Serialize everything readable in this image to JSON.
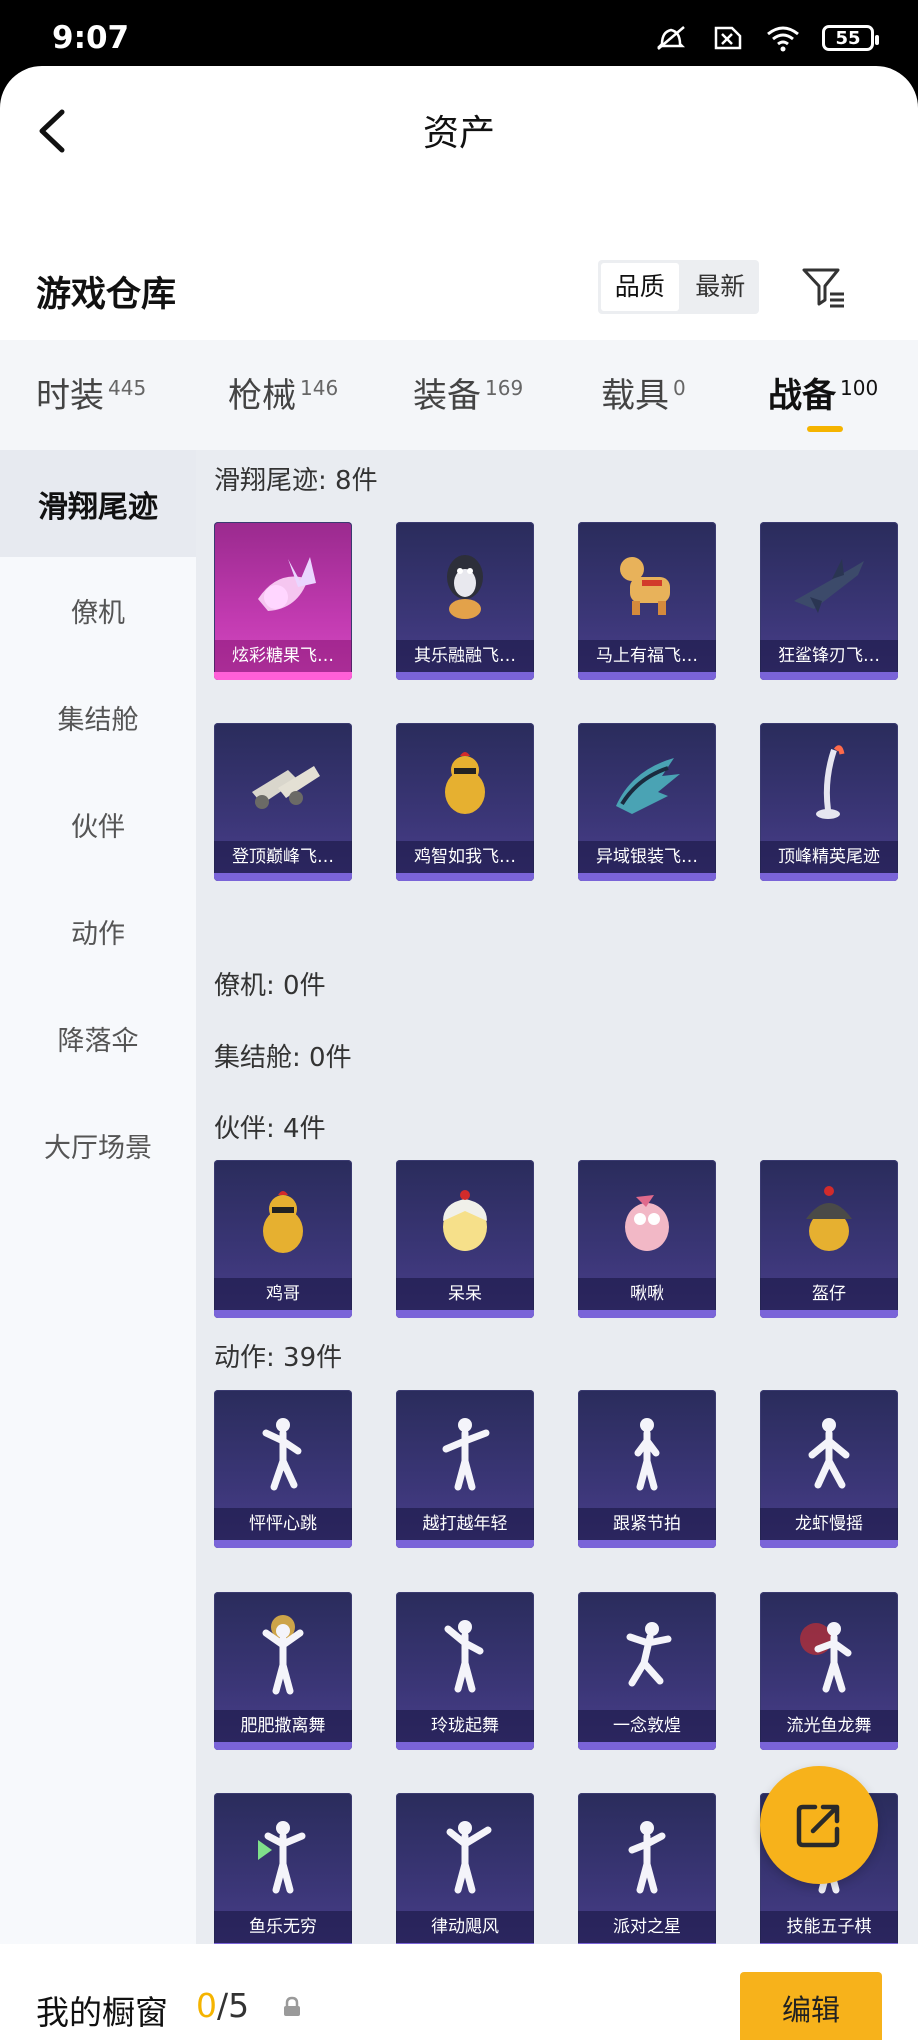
{
  "status_bar": {
    "time": "9:07",
    "battery": "55",
    "icons": [
      "mute-icon",
      "sim-off-icon",
      "wifi-icon",
      "battery-icon"
    ]
  },
  "nav": {
    "title": "资产",
    "back_icon": "chevron-left-icon"
  },
  "warehouse": {
    "title": "游戏仓库",
    "sort_options": [
      "品质",
      "最新"
    ],
    "active_sort": "品质",
    "filter_icon": "filter-icon"
  },
  "tabs": [
    {
      "label": "时装",
      "count": "445"
    },
    {
      "label": "枪械",
      "count": "146"
    },
    {
      "label": "装备",
      "count": "169"
    },
    {
      "label": "载具",
      "count": "0"
    },
    {
      "label": "战备",
      "count": "100",
      "active": true
    }
  ],
  "sidebar": {
    "items": [
      {
        "label": "滑翔尾迹",
        "active": true
      },
      {
        "label": "僚机"
      },
      {
        "label": "集结舱"
      },
      {
        "label": "伙伴"
      },
      {
        "label": "动作"
      },
      {
        "label": "降落伞"
      },
      {
        "label": "大厅场景"
      }
    ]
  },
  "sections": [
    {
      "title": "滑翔尾迹: 8件",
      "items": [
        "炫彩糖果飞…",
        "其乐融融飞…",
        "马上有福飞…",
        "狂鲨锋刃飞…",
        "登顶巅峰飞…",
        "鸡智如我飞…",
        "异域银装飞…",
        "顶峰精英尾迹"
      ]
    },
    {
      "title": "僚机: 0件",
      "items": []
    },
    {
      "title": "集结舱: 0件",
      "items": []
    },
    {
      "title": "伙伴: 4件",
      "items": [
        "鸡哥",
        "呆呆",
        "啾啾",
        "盔仔"
      ]
    },
    {
      "title": "动作: 39件",
      "items": [
        "怦怦心跳",
        "越打越年轻",
        "跟紧节拍",
        "龙虾慢摇",
        "肥肥撒离舞",
        "玲珑起舞",
        "一念敦煌",
        "流光鱼龙舞",
        "鱼乐无穷",
        "律动飓风",
        "派对之星",
        "技能五子棋"
      ]
    }
  ],
  "fab": {
    "icon": "share-export-icon"
  },
  "bottom": {
    "showcase_label": "我的橱窗",
    "current": "0",
    "total": "/5",
    "edit_label": "编辑"
  },
  "colors": {
    "accent": "#f7b21b",
    "card_bg": "#3b3677",
    "card_pink": "#c13ab0"
  }
}
